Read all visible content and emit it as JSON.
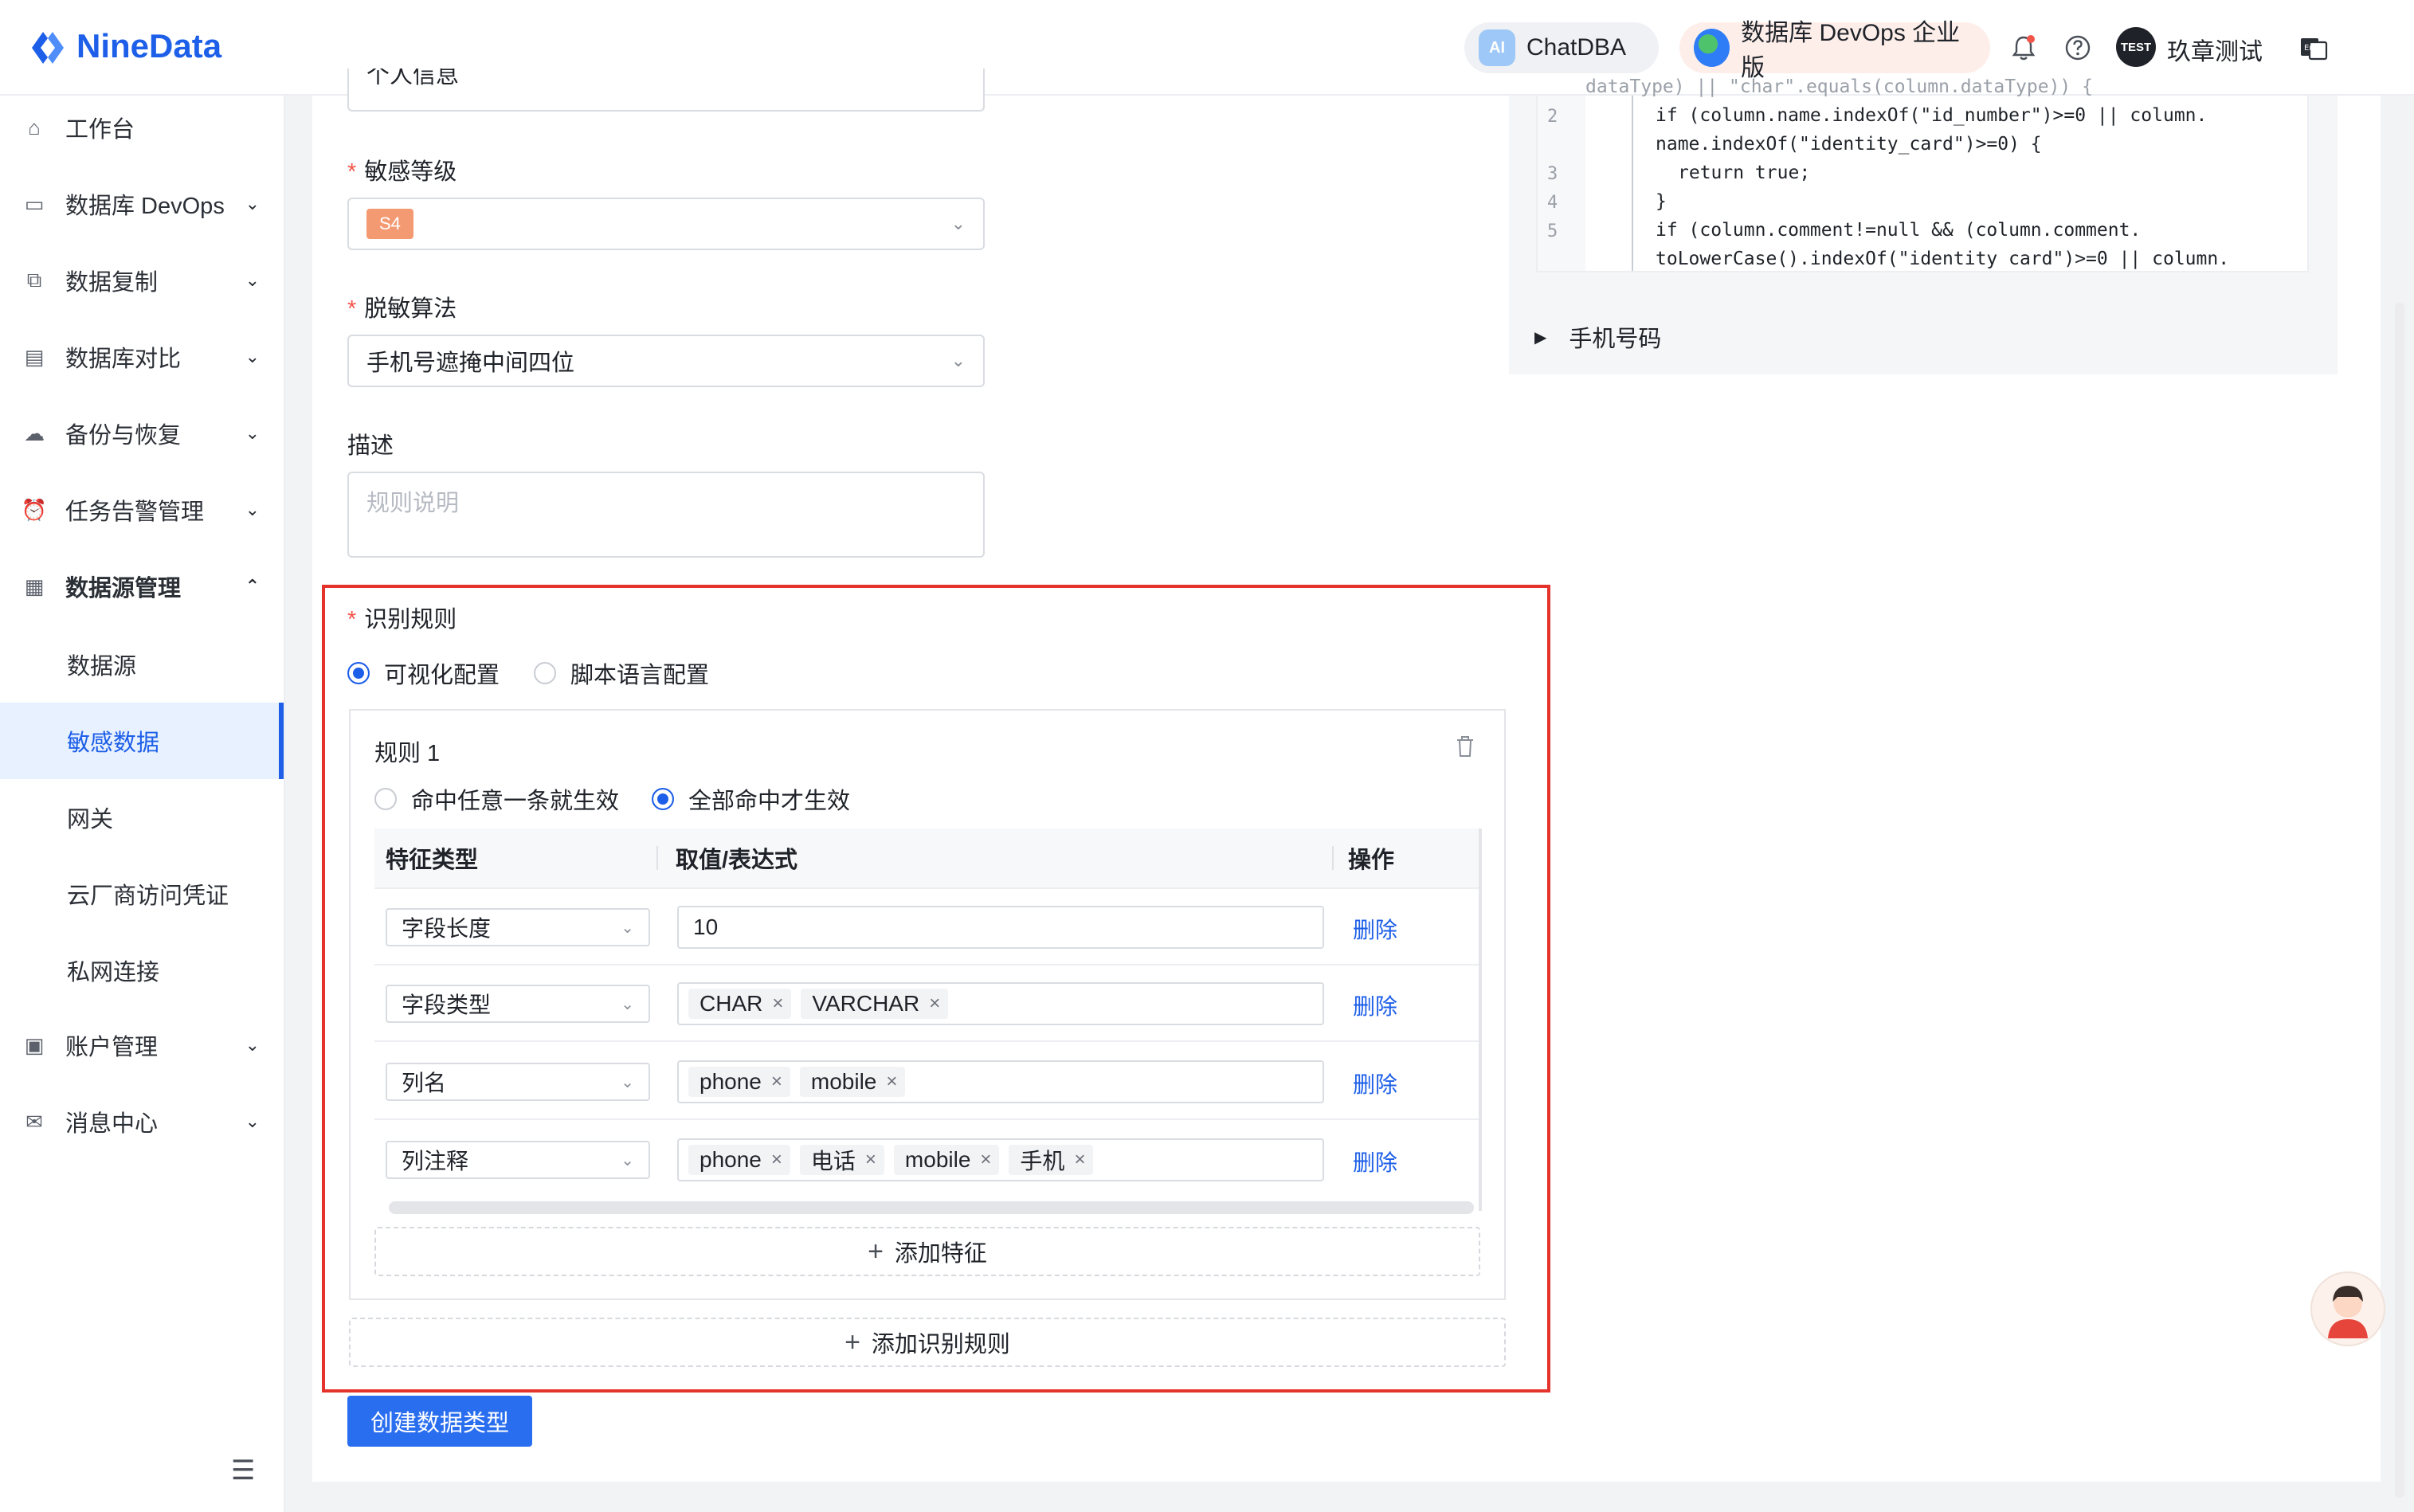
{
  "header": {
    "brand": "NineData",
    "chatdba": {
      "badge": "AI",
      "label": "ChatDBA"
    },
    "devops_label": "数据库 DevOps 企业版",
    "user_avatar_text": "TEST",
    "user_name": "玖章测试",
    "icons": [
      "bell-icon",
      "help-icon",
      "translate-icon"
    ],
    "accent": "#1d5fe8"
  },
  "sidebar": {
    "items": [
      {
        "label": "工作台",
        "icon": "home-icon"
      },
      {
        "label": "数据库 DevOps",
        "icon": "monitor-icon"
      },
      {
        "label": "数据复制",
        "icon": "copy-icon"
      },
      {
        "label": "数据库对比",
        "icon": "compare-icon"
      },
      {
        "label": "备份与恢复",
        "icon": "cloud-icon"
      },
      {
        "label": "任务告警管理",
        "icon": "alarm-icon"
      },
      {
        "label": "数据源管理",
        "icon": "datasource-icon"
      },
      {
        "label": "账户管理",
        "icon": "account-icon"
      },
      {
        "label": "消息中心",
        "icon": "mail-icon"
      }
    ],
    "sub_items": [
      "数据源",
      "敏感数据",
      "网关",
      "云厂商访问凭证",
      "私网连接"
    ],
    "active_sub": "敏感数据"
  },
  "form": {
    "top_partial_value": "个人信息",
    "level_label": "敏感等级",
    "level_value": "S4",
    "algo_label": "脱敏算法",
    "algo_value": "手机号遮掩中间四位",
    "desc_label": "描述",
    "desc_placeholder": "规则说明",
    "rules_label": "识别规则",
    "mode_visual": "可视化配置",
    "mode_script": "脚本语言配置",
    "rule_title": "规则 1",
    "match_any": "命中任意一条就生效",
    "match_all": "全部命中才生效",
    "table": {
      "headers": [
        "特征类型",
        "取值/表达式",
        "操作"
      ],
      "rows": [
        {
          "type": "字段长度",
          "text": "10",
          "chips": [],
          "action": "删除"
        },
        {
          "type": "字段类型",
          "text": "",
          "chips": [
            "CHAR",
            "VARCHAR"
          ],
          "action": "删除"
        },
        {
          "type": "列名",
          "text": "",
          "chips": [
            "phone",
            "mobile"
          ],
          "action": "删除"
        },
        {
          "type": "列注释",
          "text": "",
          "chips": [
            "phone",
            "电话",
            "mobile",
            "手机"
          ],
          "action": "删除"
        }
      ]
    },
    "add_feature": "添加特征",
    "add_rule": "添加识别规则",
    "submit": "创建数据类型"
  },
  "code": {
    "line0_partial": "dataType) || \"char\".equals(column.dataType)) {",
    "lines": [
      {
        "n": "2",
        "text": "if (column.name.indexOf(\"id_number\")>=0 || column."
      },
      {
        "n": "",
        "text": "name.indexOf(\"identity_card\")>=0) {"
      },
      {
        "n": "3",
        "text": "return true;"
      },
      {
        "n": "4",
        "text": "}"
      },
      {
        "n": "5",
        "text": "if (column.comment!=null && (column.comment."
      },
      {
        "n": "",
        "text": "toLowerCase().indexOf(\"identity card\")>=0 || column."
      }
    ],
    "collapsed_item": "手机号码"
  }
}
